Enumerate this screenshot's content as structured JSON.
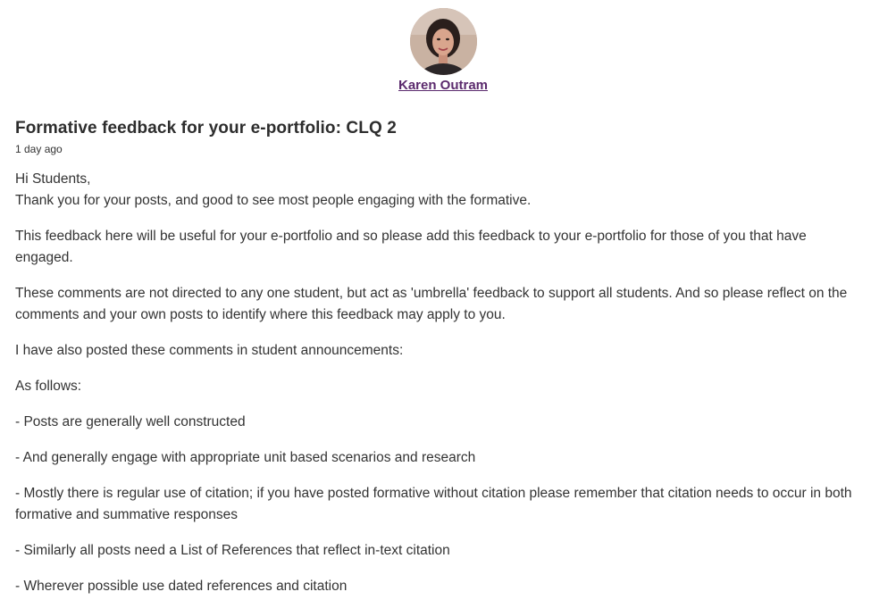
{
  "author": {
    "name": "Karen Outram",
    "avatar_icon": "profile-photo"
  },
  "post": {
    "title": "Formative feedback for your e-portfolio: CLQ 2",
    "timestamp": "1 day ago",
    "greeting": "Hi Students,",
    "intro": "Thank you for your posts, and good to see most people engaging with the formative.",
    "paragraphs": [
      "This feedback here will be useful for your e-portfolio and so please add this feedback to your e-portfolio for those of you that have engaged.",
      "These comments are not directed to any one student, but act as 'umbrella' feedback to support all students. And so please reflect on the comments and your own posts to identify where this feedback may apply to you.",
      "I have also posted these comments in student announcements:",
      "As follows:",
      "- Posts are generally well constructed",
      "- And generally engage with appropriate unit based scenarios and research",
      "- Mostly there is regular use of citation; if you have posted formative without citation please remember that citation needs to occur in both formative and summative responses",
      "- Similarly all posts need a List of References that reflect in-text citation",
      "- Wherever possible use dated references and citation"
    ]
  },
  "colors": {
    "link": "#5b2a6d",
    "text": "#333333",
    "background": "#ffffff"
  }
}
